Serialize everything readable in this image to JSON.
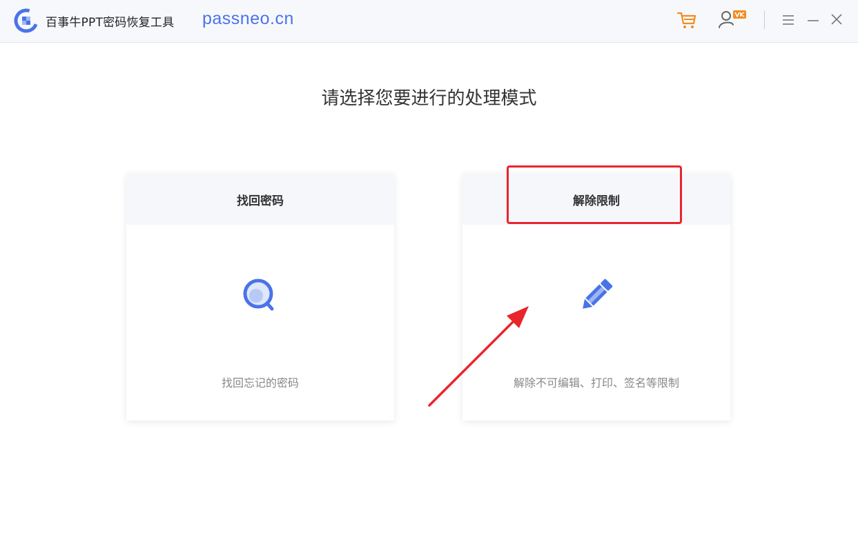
{
  "titlebar": {
    "app_title": "百事牛PPT密码恢复工具",
    "site": "passneo.cn",
    "icons": {
      "logo": "app-logo-icon",
      "cart": "shopping-cart-icon",
      "user": "user-vip-icon",
      "menu": "menu-icon",
      "minimize": "minimize-icon",
      "close": "close-icon"
    },
    "colors": {
      "accent": "#4a73e8",
      "cart": "#f28c1e",
      "vip": "#f28c1e"
    }
  },
  "main": {
    "heading": "请选择您要进行的处理模式",
    "cards": [
      {
        "title": "找回密码",
        "description": "找回忘记的密码",
        "icon": "magnifier-icon"
      },
      {
        "title": "解除限制",
        "description": "解除不可编辑、打印、签名等限制",
        "icon": "pencil-icon"
      }
    ]
  },
  "annotation": {
    "highlight_color": "#e8252b",
    "arrow_color": "#e8252b"
  }
}
